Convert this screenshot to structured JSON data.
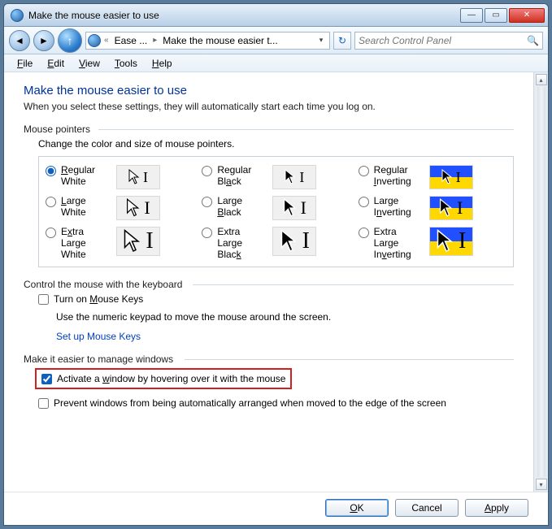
{
  "titlebar": {
    "title": "Make the mouse easier to use"
  },
  "nav": {
    "back_icon": "◄",
    "fwd_icon": "►",
    "up_icon": "↑",
    "breadcrumb1": "Ease ...",
    "breadcrumb2": "Make the mouse easier t...",
    "search_placeholder": "Search Control Panel"
  },
  "menu": {
    "file": "File",
    "edit": "Edit",
    "view": "View",
    "tools": "Tools",
    "help": "Help"
  },
  "page": {
    "heading": "Make the mouse easier to use",
    "subtitle": "When you select these settings, they will automatically start each time you log on.",
    "group_pointers": "Mouse pointers",
    "pointers_desc": "Change the color and size of mouse pointers.",
    "options": [
      {
        "label": "Regular White",
        "checked": true
      },
      {
        "label": "Regular Black",
        "checked": false
      },
      {
        "label": "Regular Inverting",
        "checked": false
      },
      {
        "label": "Large White",
        "checked": false
      },
      {
        "label": "Large Black",
        "checked": false
      },
      {
        "label": "Large Inverting",
        "checked": false
      },
      {
        "label": "Extra Large White",
        "checked": false
      },
      {
        "label": "Extra Large Black",
        "checked": false
      },
      {
        "label": "Extra Large Inverting",
        "checked": false
      }
    ],
    "group_keyboard": "Control the mouse with the keyboard",
    "mouse_keys_label": "Turn on Mouse Keys",
    "mouse_keys_desc": "Use the numeric keypad to move the mouse around the screen.",
    "mouse_keys_link": "Set up Mouse Keys",
    "group_windows": "Make it easier to manage windows",
    "activate_hover_label": "Activate a window by hovering over it with the mouse",
    "prevent_arrange_label": "Prevent windows from being automatically arranged when moved to the edge of the screen"
  },
  "buttons": {
    "ok": "OK",
    "cancel": "Cancel",
    "apply": "Apply"
  }
}
